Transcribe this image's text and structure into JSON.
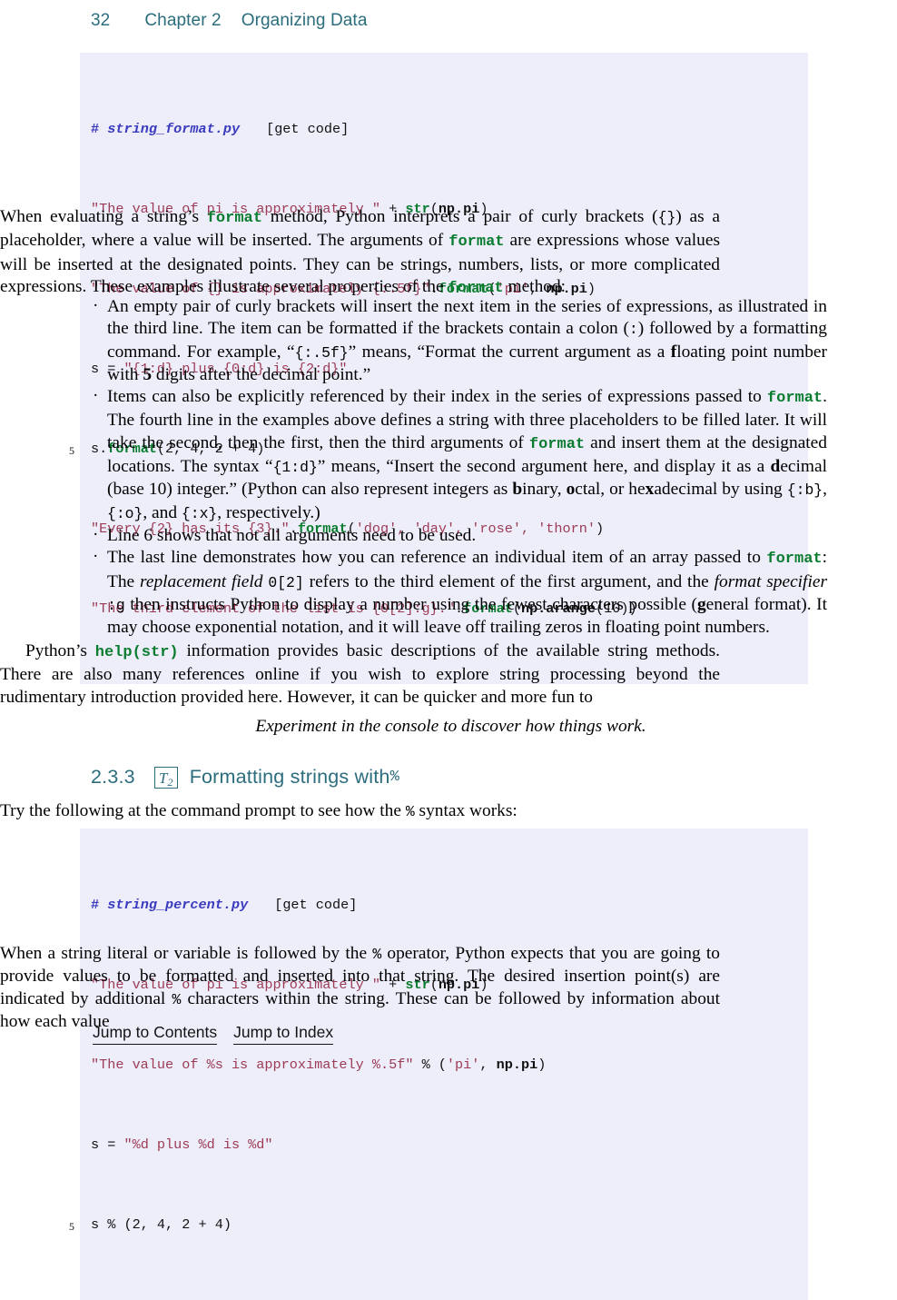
{
  "header": {
    "folio": "32",
    "chapter_number": "Chapter 2",
    "chapter_title": "Organizing Data"
  },
  "code_block_1": {
    "filename": "string_format.py",
    "get_code_label": "[get code]",
    "line_number_marker": "5",
    "lines": [
      "# string_format.py    [get code]",
      "\"The value of pi is approximately \" + str(np.pi)",
      "\"The value of {} is approximately {:.5f}\".format('pi', np.pi)",
      "s = \"{1:d} plus {0:d} is {2:d}\"",
      "s.format(2, 4, 2 + 4)",
      "\"Every {2} has its {3}.\".format('dog', 'day', 'rose', 'thorn')",
      "\"The third element of the list is {0[2]:g}.\".format(np.arange(10))"
    ],
    "line2_str": "\"The value of pi is approximately \"",
    "line2_plus": " + ",
    "line2_fn": "str",
    "line2_args": "(",
    "line2_bold": "np.pi",
    "line2_close": ")",
    "line3_str": "\"The value of {} is approximately {:.5f}\"",
    "line3_dot": ".",
    "line3_fn": "format",
    "line3_open": "(",
    "line3_arg1": "'pi'",
    "line3_comma": ", ",
    "line3_bold": "np.pi",
    "line3_close": ")",
    "line4": "s = \"{1:d} plus {0:d} is {2:d}\"",
    "line4_plain": "s = ",
    "line4_str": "\"{1:d} plus {0:d} is {2:d}\"",
    "line5_plain": "s.",
    "line5_fn": "format",
    "line5_rest": "(2, 4, 2 + 4)",
    "line6_str": "\"Every {2} has its {3}.\"",
    "line6_dot": ".",
    "line6_fn": "format",
    "line6_open": "(",
    "line6_args": "'dog', 'day', 'rose', 'thorn'",
    "line6_close": ")",
    "line7_str": "\"The third element of the list is {0[2]:g}.\"",
    "line7_dot": ".",
    "line7_fn": "format",
    "line7_open": "(",
    "line7_bold": "np.arange",
    "line7_close": "(10))"
  },
  "paragraph_1": {
    "seg1": "When evaluating a string’s ",
    "kw1": "format",
    "seg2": " method, Python interprets a pair of curly brackets (",
    "mono1": "{}",
    "seg3": ") as a placeholder, where a value will be inserted. The arguments of ",
    "kw2": "format",
    "seg4": " are expressions whose values will be inserted at the designated points. They can be strings, numbers, lists, or more complicated expressions. These examples illustrate several properties of the ",
    "kw3": "format",
    "seg5": " method:"
  },
  "bullets": [
    {
      "seg1": "An empty pair of curly brackets will insert the next item in the series of expressions, as illustrated in the third line. The item can be formatted if the brackets contain a colon (",
      "mono1": ":",
      "seg2": ") followed by a formatting command. For example, “",
      "mono2": "{:.5f}",
      "seg3": "” means, “Format the current argument as a ",
      "bold1": "f",
      "seg4": "loating point number with ",
      "bold2": "5",
      "seg5": " digits after the decimal point.”"
    },
    {
      "seg1": "Items can also be explicitly referenced by their index in the series of expressions passed to ",
      "kw1": "format",
      "seg2": ". The fourth line in the examples above defines a string with three placeholders to be filled later. It will take the second, then the first, then the third arguments of ",
      "kw2": "format",
      "seg3": " and insert them at the designated locations. The syntax “",
      "mono1": "{1:d}",
      "seg4": "” means, “Insert the second argument here, and display it as a ",
      "bold1": "d",
      "seg5": "ecimal (base 10) integer.” (Python can also represent integers as ",
      "bold2": "b",
      "seg6": "inary, ",
      "bold3": "o",
      "seg7": "ctal, or he",
      "bold4": "x",
      "seg8": "adecimal by using ",
      "mono2": "{:b}",
      "seg9": ", ",
      "mono3": "{:o}",
      "seg10": ", and ",
      "mono4": "{:x}",
      "seg11": ", respectively.)"
    },
    {
      "seg1": "Line 6 shows that not all arguments need to be used."
    },
    {
      "seg1": "The last line demonstrates how you can reference an individual item of an array passed to ",
      "kw1": "format",
      "seg2": ": The ",
      "ital1": "replacement field",
      "seg3": " ",
      "mono1": "0[2]",
      "seg4": " refers to the third element of the first argument, and the ",
      "ital2": "format specifier",
      "seg5": " ",
      "mono2": ":g",
      "seg6": " then instructs Python to display a number using the fewest characters possible (",
      "bold1": "g",
      "seg7": "eneral format). It may choose exponential notation, and it will leave off trailing zeros in floating point numbers."
    }
  ],
  "paragraph_2": {
    "seg1": "Python’s ",
    "kw1": "help(str)",
    "seg2": " information provides basic descriptions of the available string methods. There are also many references online if you wish to explore string processing beyond the rudimentary introduction provided here. However, it can be quicker and more fun to"
  },
  "callout": {
    "text": "Experiment in the console to discover how things work."
  },
  "section": {
    "number": "2.3.3",
    "badge_letter": "T",
    "badge_subscript": "2",
    "title_text": "Formatting strings with ",
    "title_mono": "%"
  },
  "paragraph_3": {
    "seg1": "Try the following at the command prompt to see how the ",
    "mono1": "%",
    "seg2": " syntax works:"
  },
  "code_block_2": {
    "filename": "string_percent.py",
    "get_code_label": "[get code]",
    "line_number_marker": "5",
    "lines": [
      "# string_percent.py    [get code]",
      "\"The value of pi is approximately \" + str(np.pi)",
      "\"The value of %s is approximately %.5f\" % ('pi', np.pi)",
      "s = \"%d plus %d is %d\"",
      "s % (2, 4, 2 + 4)"
    ],
    "line2_str": "\"The value of pi is approximately \"",
    "line2_plus": " + ",
    "line2_fn": "str",
    "line2_open": "(",
    "line2_bold": "np.pi",
    "line2_close": ")",
    "line3_str": "\"The value of %s is approximately %.5f\"",
    "line3_op": " % (",
    "line3_arg1": "'pi'",
    "line3_comma": ", ",
    "line3_bold": "np.pi",
    "line3_close": ")",
    "line4_plain": "s = ",
    "line4_str": "\"%d plus %d is %d\"",
    "line5": "s % (2, 4, 2 + 4)"
  },
  "paragraph_4": {
    "seg1": "When a string literal or variable is followed by the ",
    "mono1": "%",
    "seg2": " operator, Python expects that you are going to provide values to be formatted and inserted into that string. The desired insertion point(s) are indicated by additional ",
    "mono2": "%",
    "seg3": " characters within the string. These can be followed by information about how each value"
  },
  "footer": {
    "jump_to_contents": "Jump to Contents",
    "jump_to_index": "Jump to Index"
  },
  "colors": {
    "heading_teal": "#2b6c7d",
    "code_bg": "#eeeefa",
    "code_string": "#9c3b55",
    "code_function": "#0a7c2f",
    "code_comment": "#3b3bbf"
  }
}
